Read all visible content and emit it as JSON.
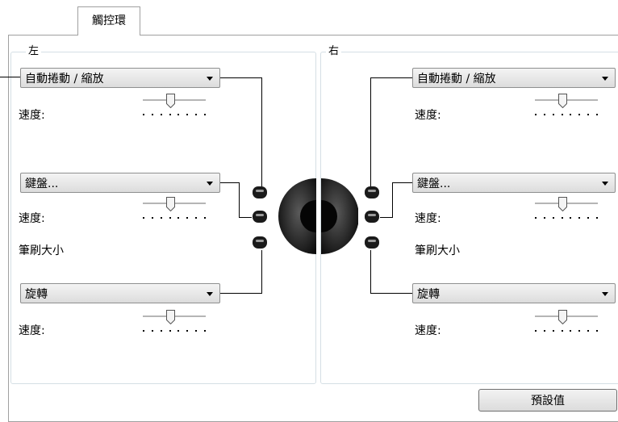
{
  "tab": {
    "label": "觸控環"
  },
  "left": {
    "title": "左",
    "rows": [
      {
        "dropdown": "自動捲動 / 縮放",
        "speed_label": "速度:",
        "extra_label": ""
      },
      {
        "dropdown": "鍵盤...",
        "speed_label": "速度:",
        "extra_label": "筆刷大小"
      },
      {
        "dropdown": "旋轉",
        "speed_label": "速度:",
        "extra_label": ""
      }
    ]
  },
  "right": {
    "title": "右",
    "rows": [
      {
        "dropdown": "自動捲動 / 縮放",
        "speed_label": "速度:",
        "extra_label": ""
      },
      {
        "dropdown": "鍵盤...",
        "speed_label": "速度:",
        "extra_label": "筆刷大小"
      },
      {
        "dropdown": "旋轉",
        "speed_label": "速度:",
        "extra_label": ""
      }
    ]
  },
  "footer": {
    "default_button": "預設值"
  },
  "icons": {
    "dropdown_arrow": "triangle-down",
    "touch_ring": "touch-ring",
    "express_button": "pill-button"
  }
}
